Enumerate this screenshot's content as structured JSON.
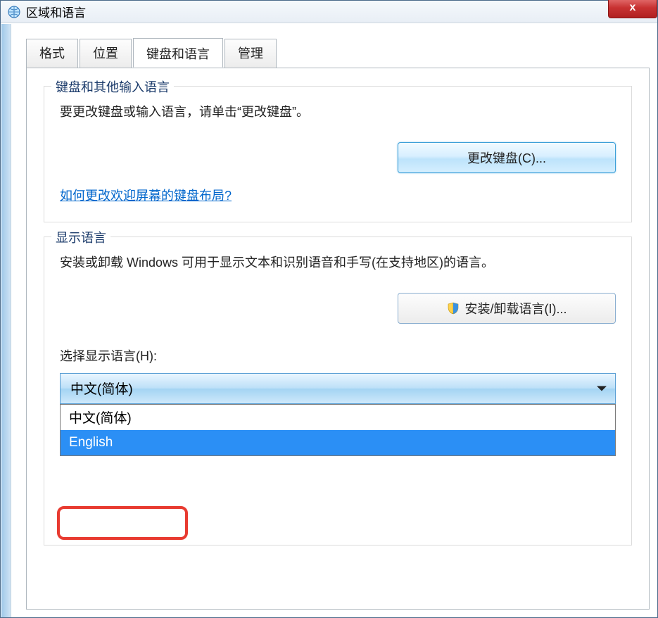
{
  "window": {
    "title": "区域和语言"
  },
  "tabs": [
    {
      "label": "格式"
    },
    {
      "label": "位置"
    },
    {
      "label": "键盘和语言",
      "active": true
    },
    {
      "label": "管理"
    }
  ],
  "group_keyboard": {
    "title": "键盘和其他输入语言",
    "description": "要更改键盘或输入语言，请单击“更改键盘”。",
    "button_label": "更改键盘(C)...",
    "link_label": "如何更改欢迎屏幕的键盘布局?"
  },
  "group_display": {
    "title": "显示语言",
    "description": "安装或卸载 Windows 可用于显示文本和识别语音和手写(在支持地区)的语言。",
    "install_button_label": "安装/卸载语言(I)...",
    "select_label": "选择显示语言(H):",
    "selected_value": "中文(简体)",
    "options": [
      "中文(简体)",
      "English"
    ],
    "highlighted_option": "English"
  }
}
